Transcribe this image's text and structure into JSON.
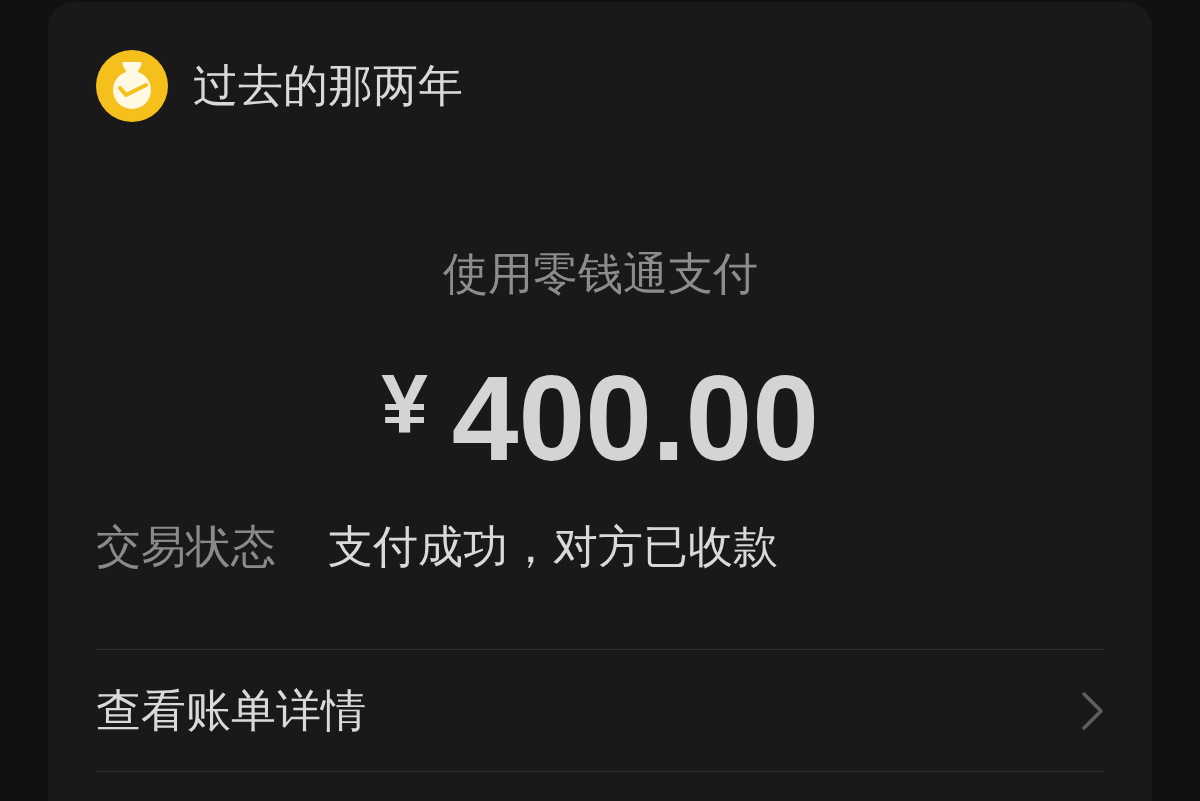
{
  "header": {
    "title": "过去的那两年"
  },
  "payment": {
    "method": "使用零钱通支付",
    "currency": "¥",
    "amount": "400.00"
  },
  "details": [
    {
      "label": "交易状态",
      "value": "支付成功，对方已收款"
    }
  ],
  "links": [
    {
      "label": "查看账单详情"
    }
  ]
}
